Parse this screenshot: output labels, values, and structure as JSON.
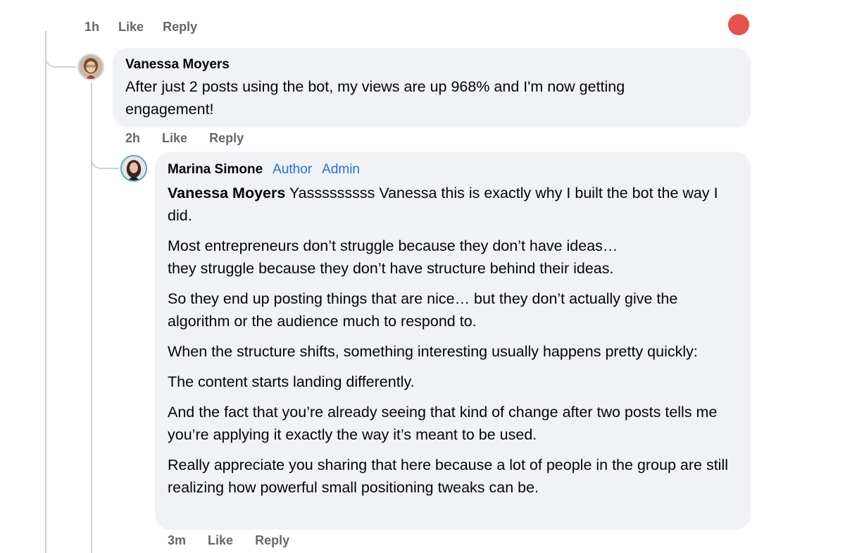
{
  "top_actions": {
    "time": "1h",
    "like": "Like",
    "reply": "Reply"
  },
  "comment_vanessa": {
    "author": "Vanessa Moyers",
    "text": "After just 2 posts using the bot, my views are up 968% and I'm now getting engagement!",
    "time": "2h",
    "like": "Like",
    "reply": "Reply"
  },
  "comment_marina": {
    "author": "Marina Simone",
    "badge_author": "Author",
    "badge_admin": "Admin",
    "mention": "Vanessa Moyers",
    "paragraphs": [
      " Yasssssssss Vanessa this is exactly why I built the bot the way I did.",
      "Most entrepreneurs don’t struggle because they don’t have ideas…\nthey struggle because they don’t have structure behind their ideas.",
      "So they end up posting things that are nice… but they don’t actually give the algorithm or the audience much to respond to.",
      "When the structure shifts, something interesting usually happens pretty quickly:",
      "The content starts landing differently.",
      "And the fact that you’re already seeing that kind of change after two posts tells me you’re applying it exactly the way it’s meant to be used.",
      "Really appreciate you sharing that here because a lot of people in the group are still realizing how powerful small positioning tweaks can be."
    ],
    "time": "3m",
    "like": "Like",
    "reply": "Reply"
  },
  "colors": {
    "bubble_bg": "#f0f2f5",
    "badge_blue": "#216fdb",
    "meta_gray": "#65676b",
    "thread_line": "#ced0d4",
    "notification_red": "#e4524d",
    "avatar_ring": "#31a24c"
  }
}
